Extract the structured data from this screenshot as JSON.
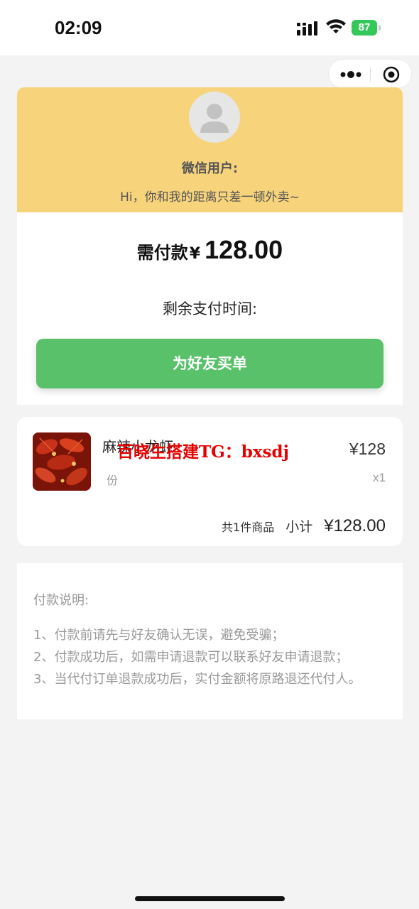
{
  "status_bar": {
    "time": "02:09",
    "battery": "87",
    "icons": [
      "signal-icon",
      "wifi-icon",
      "battery-icon"
    ]
  },
  "capsule": {
    "icons": [
      "more-icon",
      "close-mini-program-icon"
    ]
  },
  "header": {
    "user_name": "微信用户:",
    "greeting": "Hi，你和我的距离只差一顿外卖~",
    "avatar_icon": "default-avatar-icon",
    "band_color": "#f7d47c"
  },
  "payment": {
    "label": "需付款",
    "currency": "¥",
    "amount": "128.00",
    "remaining_label": "剩余支付时间:",
    "button_label": "为好友买单",
    "button_color": "#58c16a"
  },
  "goods": {
    "name": "麻辣小龙虾",
    "unit": "份",
    "price": "¥128",
    "qty": "x1",
    "count_text": "共1件商品",
    "subtotal_label": "小计",
    "subtotal": "¥128.00",
    "watermark": "百晓生搭建TG：bxsdj",
    "watermark_color": "#e60000"
  },
  "notes": {
    "title": "付款说明:",
    "items": [
      "1、付款前请先与好友确认无误，避免受骗；",
      "2、付款成功后，如需申请退款可以联系好友申请退款；",
      "3、当代付订单退款成功后，实付金额将原路退还代付人。"
    ]
  }
}
